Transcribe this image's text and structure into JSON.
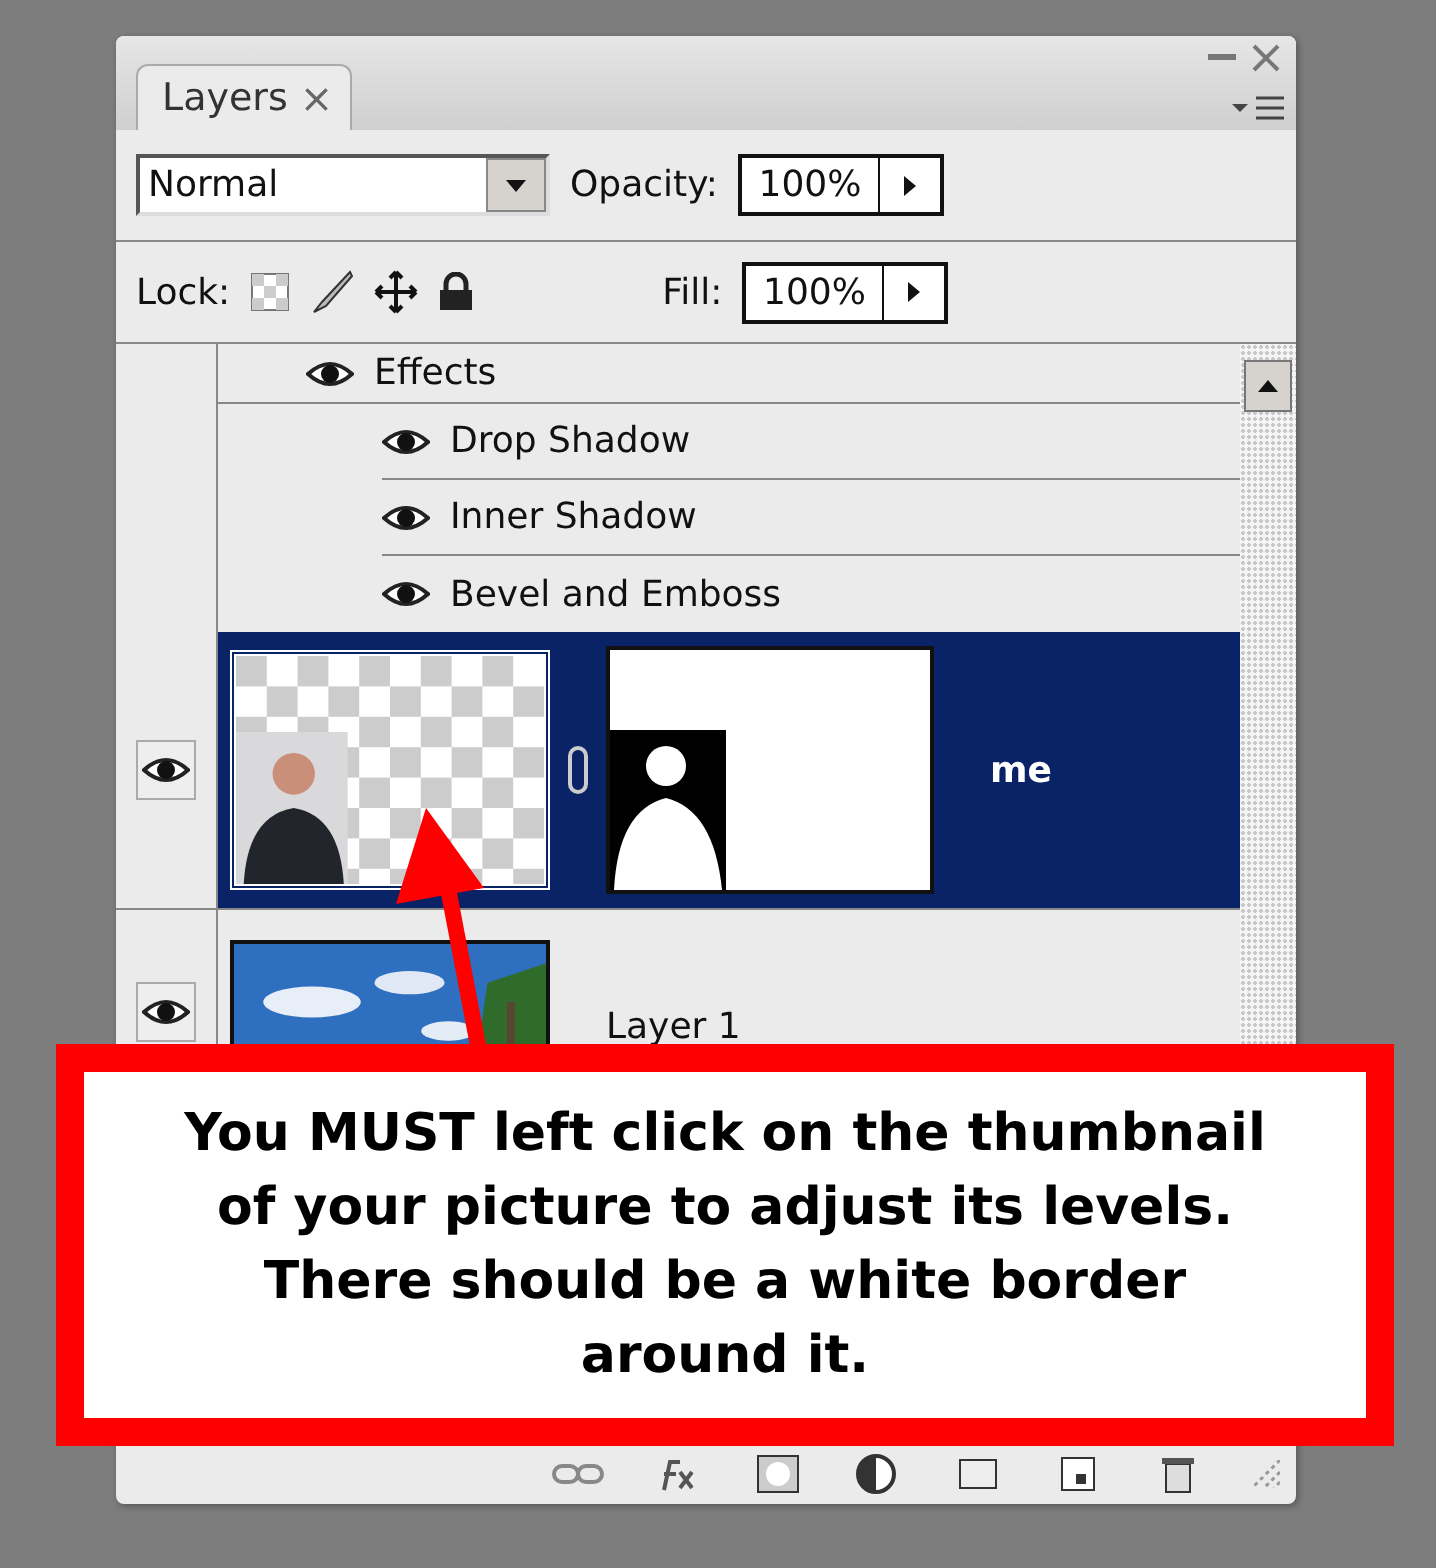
{
  "panel": {
    "tab": {
      "label": "Layers",
      "close": "×",
      "selected": true
    },
    "blend_mode": "Normal",
    "opacity": {
      "label": "Opacity:",
      "value": "100%"
    },
    "lock": {
      "label": "Lock:"
    },
    "fill": {
      "label": "Fill:",
      "value": "100%"
    }
  },
  "layers": [
    {
      "kind": "effects-header",
      "name": "Effects",
      "visible": true
    },
    {
      "kind": "effect",
      "name": "Drop Shadow",
      "visible": true
    },
    {
      "kind": "effect",
      "name": "Inner Shadow",
      "visible": true
    },
    {
      "kind": "effect",
      "name": "Bevel and Emboss",
      "visible": true
    },
    {
      "kind": "layer",
      "name": "me",
      "selected": true,
      "visible": true,
      "masked": true
    },
    {
      "kind": "layer",
      "name": "Layer 1",
      "selected": false,
      "visible": true,
      "masked": false
    }
  ],
  "callout": {
    "text": "You MUST left click on the thumbnail of your picture to adjust its levels. There should be a white border around it."
  }
}
